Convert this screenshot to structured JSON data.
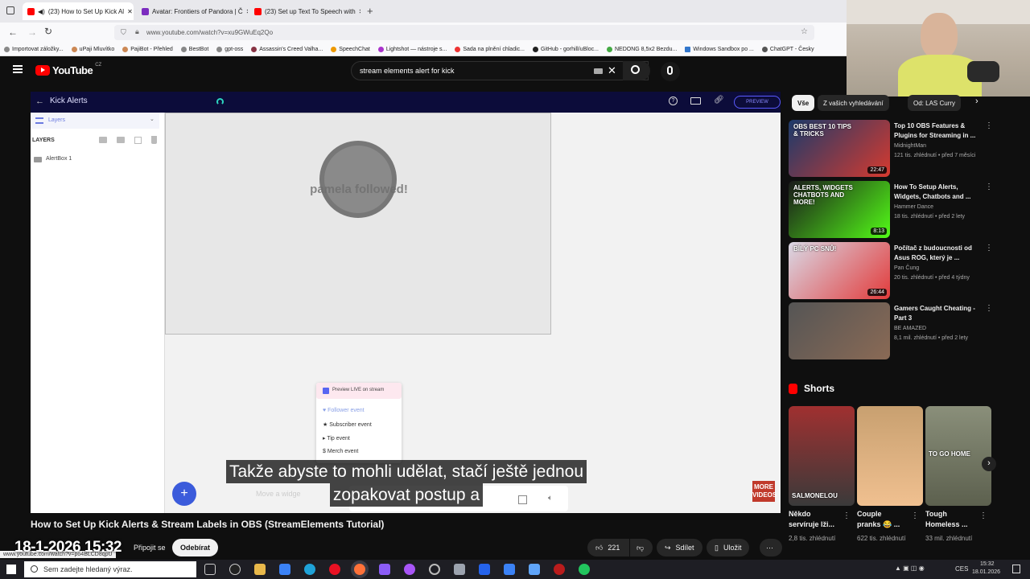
{
  "tabs": [
    {
      "label": "(23) How to Set Up Kick Al",
      "color": "#ff0000",
      "active": true
    },
    {
      "label": "Avatar: Frontiers of Pandora | Č",
      "color": "#7b2cbf"
    },
    {
      "label": "(23) Set up Text To Speech with",
      "color": "#ff0000"
    }
  ],
  "url": "www.youtube.com/watch?v=xu9GWuEq2Qo",
  "bookmarks": [
    "Importovat záložky...",
    "uPaji Mluvítko",
    "PajiBot - Přehled",
    "BestBot",
    "gpt-oss",
    "Assassin's Creed Valha...",
    "SpeechChat",
    "Lightshot — nástroje s...",
    "Sada na plnění chladic...",
    "GitHub - gorhill/uBloc...",
    "NEDONG 8,5x2 Bezdu...",
    "Windows Sandbox po ...",
    "ChatGPT - Česky"
  ],
  "youtube": {
    "logo": "YouTube",
    "region": "CZ",
    "search_value": "stream elements alert for kick"
  },
  "video": {
    "app_title": "Kick Alerts",
    "preview_label": "PREVIEW",
    "layers_tab": "Layers",
    "layers_heading": "LAYERS",
    "layer_item": "AlertBox 1",
    "canvas_text": "pamela followed!",
    "preview_live": "Preview LIVE on stream",
    "events": [
      "Follower event",
      "Subscriber event",
      "Tip event",
      "Merch event"
    ],
    "hint_text": "Move a widge",
    "subtitle_line1": "Takže abyste to mohli udělat, stačí ještě jednou",
    "subtitle_line2": "zopakovat postup a",
    "more_videos": "MORE VIDEOS"
  },
  "title": "How to Set Up Kick Alerts & Stream Labels in OBS (StreamElements Tutorial)",
  "actions": {
    "join": "Připojit se",
    "subscribe": "Odebírat",
    "likes": "221",
    "share": "Sdílet",
    "save": "Uložit"
  },
  "chips": [
    "Vše",
    "Z vašich vyhledávání",
    "Od: LAS Curry"
  ],
  "recommendations": [
    {
      "title": "Top 10 OBS Features & Plugins for Streaming in ...",
      "channel": "MidnightMan",
      "meta": "121 tis. zhlédnutí • před 7 měsíci",
      "duration": "22:47",
      "thumb_text": "OBS BEST 10 TIPS & TRICKS",
      "c1": "#1b3a6b",
      "c2": "#d63a2f"
    },
    {
      "title": "How To Setup Alerts, Widgets, Chatbots and ...",
      "channel": "Hammer Dance",
      "meta": "18 tis. zhlédnutí • před 2 lety",
      "duration": "8:13",
      "thumb_text": "ALERTS, WIDGETS CHATBOTS AND MORE!",
      "c1": "#1a1a1a",
      "c2": "#53fc18"
    },
    {
      "title": "Počítač z budoucnosti od Asus ROG, který je ...",
      "channel": "Pan Čung",
      "meta": "20 tis. zhlédnutí • před 4 týdny",
      "duration": "26:44",
      "thumb_text": "BÍLÝ PC SNŮ!",
      "c1": "#d9d9e6",
      "c2": "#e23b3b"
    },
    {
      "title": "Gamers Caught Cheating - Part 3",
      "channel": "BE AMAZED",
      "meta": "8,1 mil. zhlédnutí • před 2 lety",
      "duration": "",
      "thumb_text": "",
      "c1": "#555",
      "c2": "#8a6a55"
    }
  ],
  "shorts_heading": "Shorts",
  "shorts": [
    {
      "title": "Někdo servíruje lži...",
      "views": "2,8 tis. zhlédnutí",
      "overlay": "SALMONELOU",
      "c1": "#a03030",
      "c2": "#3a3a3a"
    },
    {
      "title": "Couple pranks 😂 ...",
      "views": "622 tis. zhlédnutí",
      "overlay": "",
      "c1": "#c8a070",
      "c2": "#f0c090"
    },
    {
      "title": "Tough Homeless ...",
      "views": "33 mil. zhlédnutí",
      "overlay": "TO GO HOME",
      "c1": "#8a8f7a",
      "c2": "#5c604e"
    }
  ],
  "status_url": "www.youtube.com/watch?v=po4BLCD8qpU",
  "timestamp": "18-1-2026 15:32",
  "taskbar": {
    "search_placeholder": "Sem zadejte hledaný výraz.",
    "lang": "CES",
    "time": "15:32",
    "date": "18.01.2026"
  }
}
